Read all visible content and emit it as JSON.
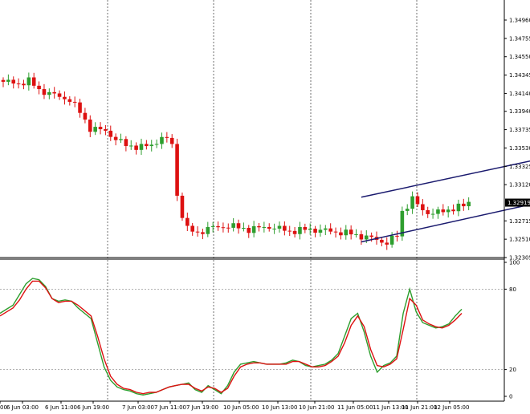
{
  "chart_data": [
    {
      "type": "candlestick",
      "title": "",
      "ylim": [
        1.32305,
        1.35165
      ],
      "y_ticks": [
        "1.34960",
        "1.34755",
        "1.34550",
        "1.34345",
        "1.34140",
        "1.33940",
        "1.33735",
        "1.33530",
        "1.33325",
        "1.33120",
        "1.32715",
        "1.32510",
        "1.32305"
      ],
      "current_price": "1.32919",
      "x_tick_labels": [
        "00",
        "6 Jun 03:00",
        "6 Jun 11:00",
        "6 Jun 19:00",
        "7 Jun 03:00",
        "7 Jun 11:00",
        "7 Jun 19:00",
        "10 Jun 05:00",
        "10 Jun 13:00",
        "10 Jun 21:00",
        "11 Jun 05:00",
        "11 Jun 13:00",
        "11 Jun 21:00",
        "12 Jun 05:00"
      ],
      "colors": {
        "up": "#2e9e2e",
        "down": "#dd1111",
        "trendline": "#1a1a6e",
        "label_bg": "#000000"
      },
      "anchors": [
        [
          0,
          1.3427
        ],
        [
          3,
          1.3425
        ],
        [
          5,
          1.3428
        ],
        [
          7,
          1.3418
        ],
        [
          10,
          1.3412
        ],
        [
          13,
          1.3407
        ],
        [
          15,
          1.3393
        ],
        [
          17,
          1.3375
        ],
        [
          20,
          1.3372
        ],
        [
          22,
          1.3363
        ],
        [
          24,
          1.3356
        ],
        [
          27,
          1.3354
        ],
        [
          29,
          1.3356
        ],
        [
          31,
          1.3365
        ],
        [
          33,
          1.3358
        ],
        [
          34,
          1.33
        ],
        [
          35,
          1.3278
        ],
        [
          36,
          1.3262
        ],
        [
          38,
          1.3258
        ],
        [
          40,
          1.3263
        ],
        [
          44,
          1.3266
        ],
        [
          48,
          1.3262
        ],
        [
          52,
          1.3265
        ],
        [
          56,
          1.326
        ],
        [
          60,
          1.3262
        ],
        [
          64,
          1.326
        ],
        [
          68,
          1.3257
        ],
        [
          72,
          1.3252
        ],
        [
          75,
          1.3247
        ],
        [
          77,
          1.3255
        ],
        [
          78,
          1.3282
        ],
        [
          80,
          1.3296
        ],
        [
          82,
          1.3283
        ],
        [
          84,
          1.328
        ],
        [
          86,
          1.3282
        ],
        [
          88,
          1.3286
        ],
        [
          90,
          1.3288
        ],
        [
          91,
          1.3292
        ]
      ],
      "trend_channel": {
        "upper": {
          "start": [
            70,
            1.3298
          ],
          "end": [
            119,
            1.3358
          ]
        },
        "lower": {
          "start": [
            70,
            1.3248
          ],
          "end": [
            119,
            1.331
          ]
        }
      }
    },
    {
      "type": "line",
      "ylim": [
        0,
        100
      ],
      "y_ticks": [
        "100",
        "80",
        "20",
        "0"
      ],
      "levels": [
        80,
        20
      ],
      "series": [
        {
          "color": "#2e9e2e",
          "values": [
            62,
            65,
            68,
            76,
            84,
            88,
            87,
            82,
            73,
            71,
            72,
            71,
            66,
            62,
            58,
            40,
            22,
            12,
            7,
            5,
            4,
            2,
            1,
            2,
            3,
            5,
            7,
            8,
            9,
            10,
            5,
            3,
            8,
            5,
            2,
            8,
            18,
            24,
            25,
            26,
            25,
            24,
            24,
            24,
            25,
            27,
            26,
            23,
            22,
            23,
            24,
            27,
            32,
            45,
            58,
            62,
            48,
            30,
            18,
            23,
            25,
            30,
            62,
            80,
            63,
            55,
            53,
            51,
            52,
            54,
            60,
            65
          ]
        },
        {
          "color": "#dd1111",
          "values": [
            60,
            63,
            66,
            72,
            80,
            86,
            86,
            81,
            73,
            70,
            71,
            71,
            68,
            64,
            60,
            45,
            28,
            15,
            9,
            6,
            5,
            3,
            2,
            3,
            3,
            5,
            7,
            8,
            9,
            9,
            6,
            4,
            7,
            6,
            3,
            6,
            15,
            22,
            24,
            25,
            25,
            24,
            24,
            24,
            24,
            26,
            26,
            24,
            22,
            22,
            23,
            26,
            30,
            40,
            53,
            60,
            52,
            35,
            23,
            22,
            24,
            28,
            50,
            73,
            68,
            57,
            54,
            52,
            51,
            53,
            57,
            62
          ]
        }
      ]
    }
  ]
}
